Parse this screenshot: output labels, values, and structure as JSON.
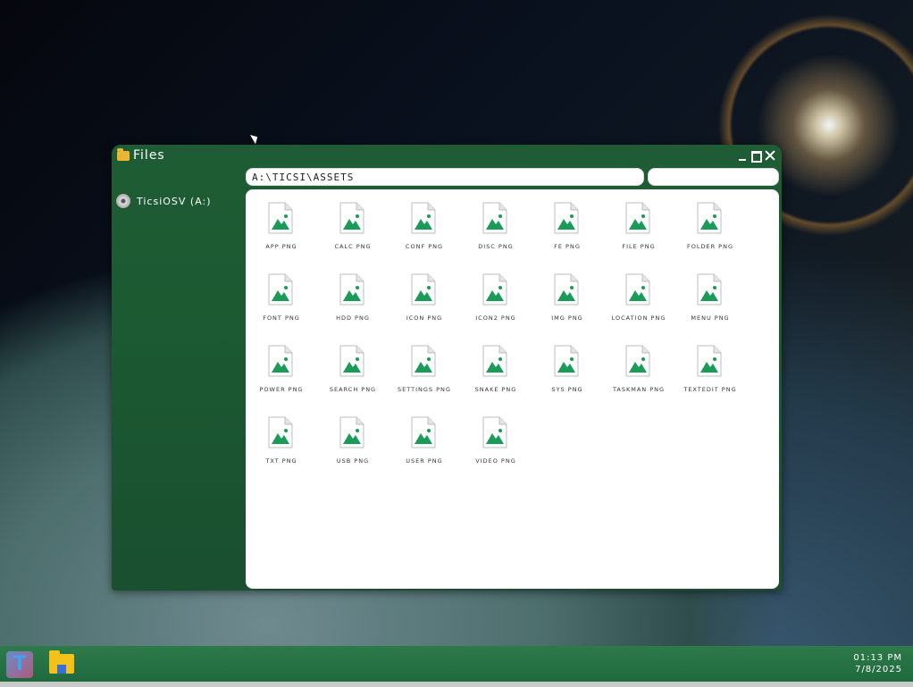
{
  "window": {
    "title": "Files",
    "path": "A:\\TICSI\\ASSETS",
    "search_value": ""
  },
  "sidebar": {
    "items": [
      {
        "label": "TicsiOSV (A:)",
        "icon": "disc-icon"
      }
    ]
  },
  "files": [
    "APP PNG",
    "CALC PNG",
    "CONF PNG",
    "DISC PNG",
    "FE PNG",
    "FILE PNG",
    "FOLDER PNG",
    "FONT PNG",
    "HDD PNG",
    "ICON PNG",
    "ICON2 PNG",
    "IMG PNG",
    "LOCATION PNG",
    "MENU PNG",
    "POWER PNG",
    "SEARCH PNG",
    "SETTINGS PNG",
    "SNAKE PNG",
    "SYS PNG",
    "TASKMAN PNG",
    "TEXTEDIT PNG",
    "TXT PNG",
    "USB PNG",
    "USER PNG",
    "VIDEO PNG"
  ],
  "taskbar": {
    "time": "01:13 PM",
    "date": "7/8/2025",
    "apps": [
      {
        "label": "T",
        "icon": "ticsi-app-icon"
      },
      {
        "label": "",
        "icon": "files-app-icon"
      }
    ]
  },
  "colors": {
    "window_green": "#1f5c35",
    "taskbar_green": "#2e7a4a",
    "file_icon_green": "#1a9b57"
  }
}
